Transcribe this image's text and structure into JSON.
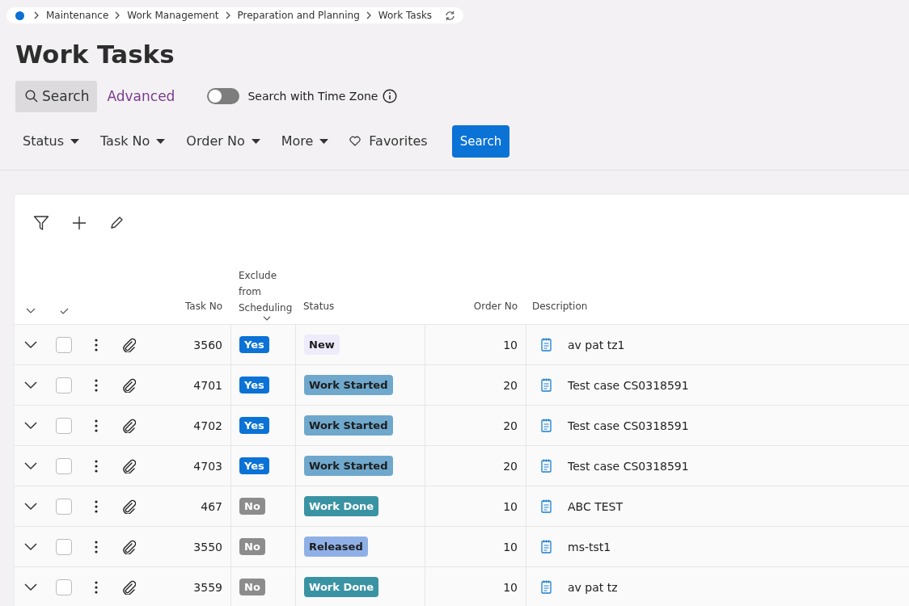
{
  "breadcrumb": [
    "Maintenance",
    "Work Management",
    "Preparation and Planning",
    "Work Tasks"
  ],
  "title": "Work Tasks",
  "search_tabs": [
    {
      "label": "Search",
      "selected": true
    },
    {
      "label": "Advanced",
      "selected": false
    }
  ],
  "timezone_toggle": {
    "label": "Search with Time Zone",
    "on": false
  },
  "filters": [
    "Status",
    "Task No",
    "Order No",
    "More"
  ],
  "favorites": "Favorites",
  "search_button": "Search",
  "table": {
    "columns": [
      "Task No",
      "Exclude from Scheduling",
      "Status",
      "Order No",
      "Description"
    ],
    "rows": [
      {
        "task_no": "3560",
        "exclude": {
          "text": "Yes",
          "on": true
        },
        "status": {
          "text": "New",
          "color": "#eeebfb"
        },
        "order_no": "10",
        "description": "av pat tz1",
        "checked": false
      },
      {
        "task_no": "4701",
        "exclude": {
          "text": "Yes",
          "on": true
        },
        "status": {
          "text": "Work Started",
          "color": "#6fa8cc"
        },
        "order_no": "20",
        "description": "Test case CS0318591",
        "checked": false
      },
      {
        "task_no": "4702",
        "exclude": {
          "text": "Yes",
          "on": true
        },
        "status": {
          "text": "Work Started",
          "color": "#6fa8cc"
        },
        "order_no": "20",
        "description": "Test case CS0318591",
        "checked": false
      },
      {
        "task_no": "4703",
        "exclude": {
          "text": "Yes",
          "on": true
        },
        "status": {
          "text": "Work Started",
          "color": "#6fa8cc"
        },
        "order_no": "20",
        "description": "Test case CS0318591",
        "checked": false
      },
      {
        "task_no": "467",
        "exclude": {
          "text": "No",
          "on": false
        },
        "status": {
          "text": "Work Done",
          "color": "#3a93a3"
        },
        "order_no": "10",
        "description": "ABC TEST",
        "checked": false
      },
      {
        "task_no": "3550",
        "exclude": {
          "text": "No",
          "on": false
        },
        "status": {
          "text": "Released",
          "color": "#8fb0e6"
        },
        "order_no": "10",
        "description": "ms-tst1",
        "checked": false
      },
      {
        "task_no": "3559",
        "exclude": {
          "text": "No",
          "on": false
        },
        "status": {
          "text": "Work Done",
          "color": "#3a93a3"
        },
        "order_no": "10",
        "description": "av pat tz",
        "checked": false
      }
    ]
  }
}
